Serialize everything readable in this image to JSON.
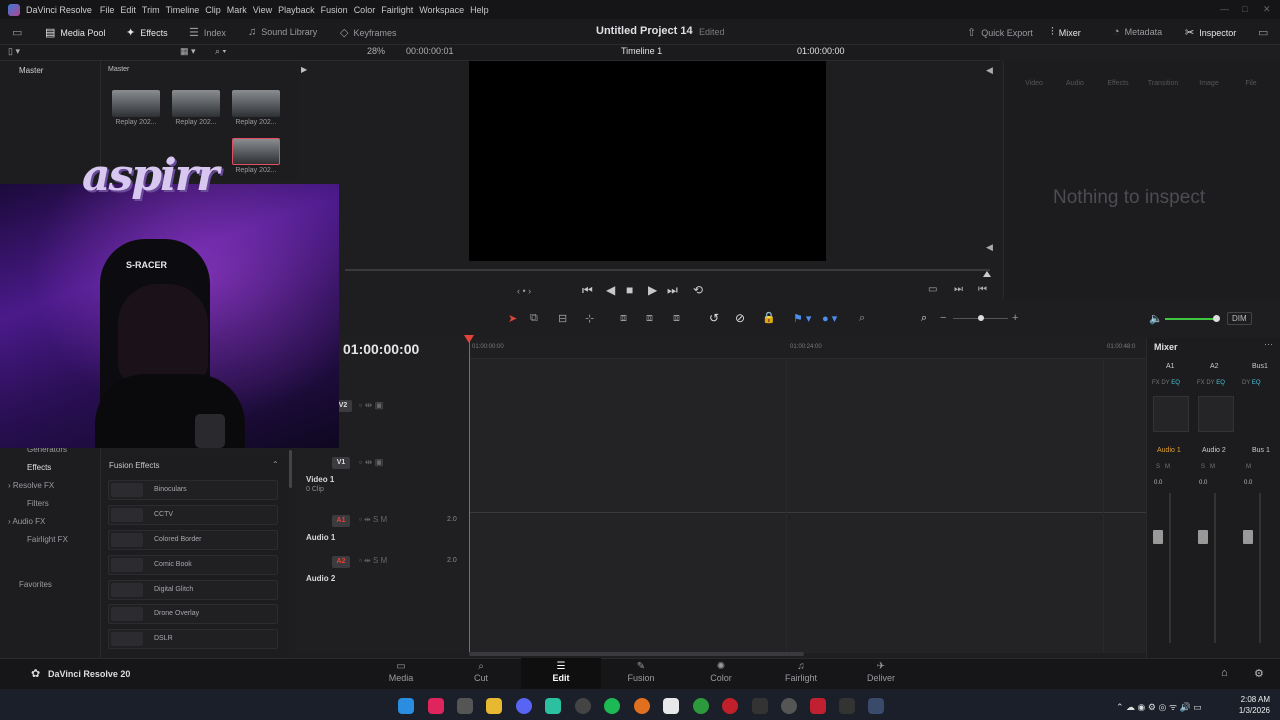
{
  "app": {
    "name": "DaVinci Resolve",
    "version_label": "DaVinci Resolve 20"
  },
  "menu": [
    "File",
    "Edit",
    "Trim",
    "Timeline",
    "Clip",
    "Mark",
    "View",
    "Playback",
    "Fusion",
    "Color",
    "Fairlight",
    "Workspace",
    "Help"
  ],
  "toolbar": {
    "media_pool": "Media Pool",
    "effects": "Effects",
    "index": "Index",
    "sound_library": "Sound Library",
    "keyframes": "Keyframes",
    "project_title": "Untitled Project 14",
    "edited": "Edited",
    "quick_export": "Quick Export",
    "mixer": "Mixer",
    "metadata": "Metadata",
    "inspector": "Inspector"
  },
  "subbar": {
    "zoom": "28%",
    "source_tc": "00:00:00:01",
    "timeline_name": "Timeline 1",
    "record_tc": "01:00:00:00"
  },
  "media_pool": {
    "left_title": "Master",
    "right_title": "Master",
    "clips": [
      "Replay 202...",
      "Replay 202...",
      "Replay 202...",
      "Replay 202..."
    ]
  },
  "inspector": {
    "tabs": [
      "Video",
      "Audio",
      "Effects",
      "Transition",
      "Image",
      "File"
    ],
    "empty_text": "Nothing to inspect"
  },
  "timeline": {
    "timecode": "01:00:00:00",
    "ruler": [
      "01:00:00:00",
      "01:00:24:00",
      "01:00:48:0"
    ],
    "tracks": [
      {
        "badge": "V2",
        "name": "",
        "sub": ""
      },
      {
        "badge": "V1",
        "name": "Video 1",
        "sub": "0 Clip"
      },
      {
        "badge": "A1",
        "name": "Audio 1",
        "sub": "",
        "level": "2.0"
      },
      {
        "badge": "A2",
        "name": "Audio 2",
        "sub": "",
        "level": "2.0"
      }
    ]
  },
  "mixer": {
    "title": "Mixer",
    "channels": [
      "A1",
      "A2",
      "Bus1"
    ],
    "channel_names": [
      "Audio 1",
      "Audio 2",
      "Bus 1"
    ],
    "values": [
      "0.0",
      "0.0",
      "0.0"
    ],
    "fx_labels": [
      "FX",
      "DY",
      "EQ"
    ],
    "dim": "DIM"
  },
  "effects_panel": {
    "left_items": [
      "Generators",
      "Effects",
      "Resolve FX",
      "Filters",
      "Audio FX",
      "Fairlight FX",
      "Favorites"
    ],
    "section_title": "Fusion Effects",
    "items": [
      "Binoculars",
      "CCTV",
      "Colored Border",
      "Comic Book",
      "Digital Glitch",
      "Drone Overlay",
      "DSLR"
    ]
  },
  "webcam_overlay": {
    "brand": "aspirr",
    "chair": "S-RACER"
  },
  "pages": [
    "Media",
    "Cut",
    "Edit",
    "Fusion",
    "Color",
    "Fairlight",
    "Deliver"
  ],
  "taskbar": {
    "time": "2:08 AM",
    "date": "1/3/2026"
  },
  "colors": {
    "accent": "#e0443a",
    "active_tab": "#ffffff",
    "audio_badge": "#d24b3e",
    "video_badge": "#3b3b3f"
  }
}
